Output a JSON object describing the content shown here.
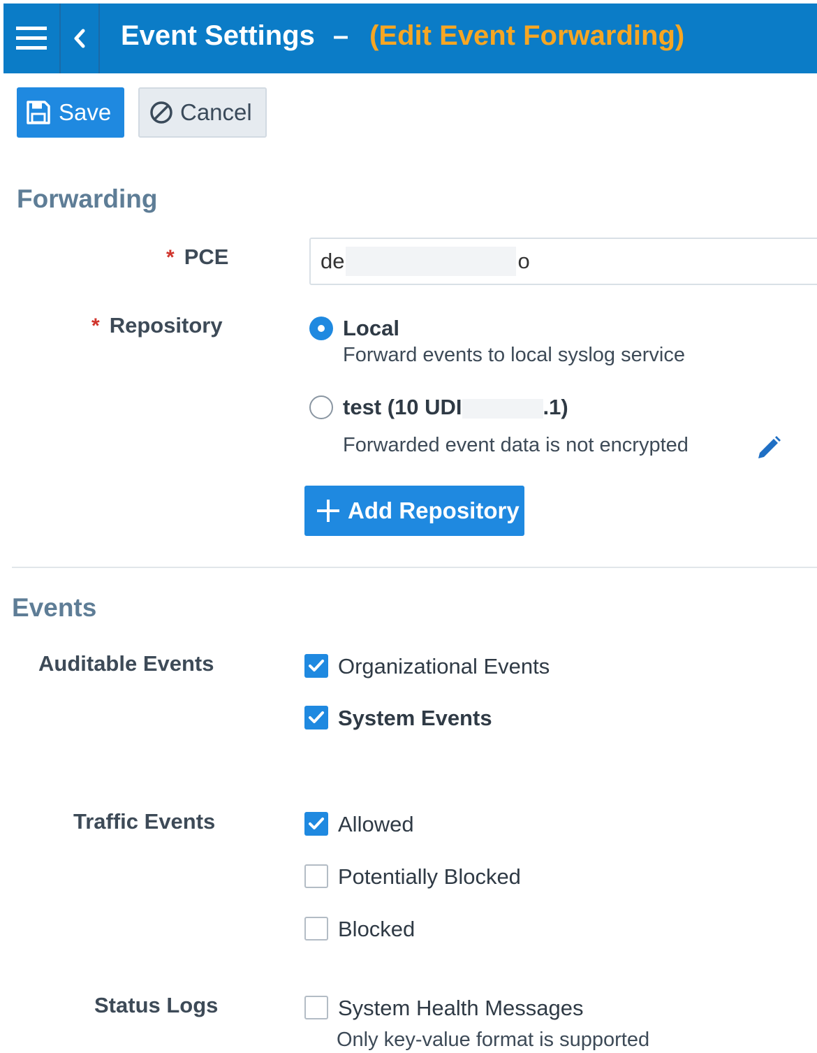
{
  "header": {
    "title": "Event Settings",
    "separator": "–",
    "subtitle": "(Edit Event Forwarding)"
  },
  "toolbar": {
    "save_label": "Save",
    "cancel_label": "Cancel"
  },
  "forwarding": {
    "section_title": "Forwarding",
    "pce_label": "PCE",
    "pce_value_start": "de",
    "pce_value_end": "o",
    "repository_label": "Repository",
    "repositories": [
      {
        "name": "Local",
        "description": "Forward events to local syslog service",
        "selected": true
      },
      {
        "name_start": "test (10 UDI",
        "name_end": ".1)",
        "description": "Forwarded event data is not encrypted",
        "selected": false
      }
    ],
    "add_repository_label": "Add Repository"
  },
  "events": {
    "section_title": "Events",
    "auditable_label": "Auditable Events",
    "auditable": [
      {
        "label": "Organizational Events",
        "checked": true
      },
      {
        "label": "System Events",
        "checked": true
      }
    ],
    "traffic_label": "Traffic Events",
    "traffic": [
      {
        "label": "Allowed",
        "checked": true
      },
      {
        "label": "Potentially Blocked",
        "checked": false
      },
      {
        "label": "Blocked",
        "checked": false
      }
    ],
    "status_label": "Status Logs",
    "status": [
      {
        "label": "System Health Messages",
        "checked": false,
        "note": "Only key-value format is supported"
      }
    ]
  },
  "icons": {
    "menu": "hamburger-menu-icon",
    "back": "chevron-left-icon",
    "save": "floppy-disk-icon",
    "cancel": "cancel-circle-icon",
    "edit": "pencil-icon",
    "add": "plus-icon",
    "check": "checkmark-icon"
  },
  "colors": {
    "header_bg": "#0b7cc7",
    "subtitle": "#f6a623",
    "primary": "#1f89e0",
    "required": "#d0342c",
    "section_title": "#5e7d96"
  }
}
